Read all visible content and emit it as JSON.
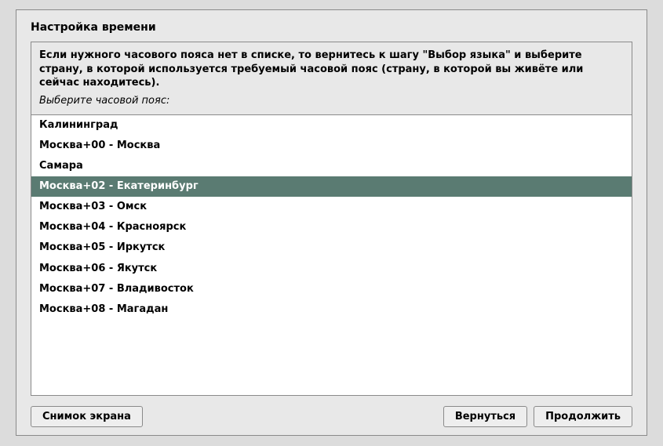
{
  "title": "Настройка времени",
  "instruction": "Если нужного часового пояса нет в списке, то вернитесь к шагу \"Выбор языка\" и выберите страну, в которой используется требуемый часовой пояс (страну, в которой вы живёте или сейчас находитесь).",
  "prompt": "Выберите часовой пояс:",
  "timezones": [
    {
      "label": "Калининград",
      "selected": false
    },
    {
      "label": "Москва+00 - Москва",
      "selected": false
    },
    {
      "label": "Самара",
      "selected": false
    },
    {
      "label": "Москва+02 - Екатеринбург",
      "selected": true
    },
    {
      "label": "Москва+03 - Омск",
      "selected": false
    },
    {
      "label": "Москва+04 - Красноярск",
      "selected": false
    },
    {
      "label": "Москва+05 - Иркутск",
      "selected": false
    },
    {
      "label": "Москва+06 - Якутск",
      "selected": false
    },
    {
      "label": "Москва+07 - Владивосток",
      "selected": false
    },
    {
      "label": "Москва+08 - Магадан",
      "selected": false
    }
  ],
  "buttons": {
    "screenshot": "Снимок экрана",
    "back": "Вернуться",
    "continue": "Продолжить"
  }
}
